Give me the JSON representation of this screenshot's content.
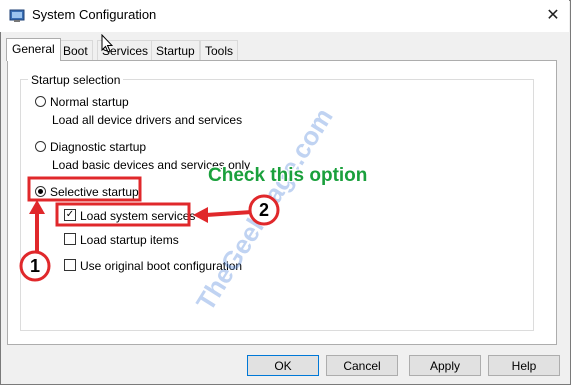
{
  "window": {
    "title": "System Configuration",
    "close_glyph": "✕"
  },
  "tabs": [
    {
      "label": "General"
    },
    {
      "label": "Boot"
    },
    {
      "label": "Services"
    },
    {
      "label": "Startup"
    },
    {
      "label": "Tools"
    }
  ],
  "general": {
    "group_label": "Startup selection",
    "normal": {
      "label": "Normal startup",
      "desc": "Load all device drivers and services"
    },
    "diagnostic": {
      "label": "Diagnostic startup",
      "desc": "Load basic devices and services only"
    },
    "selective": {
      "label": "Selective startup",
      "selected": true
    },
    "options": [
      {
        "label": "Load system services",
        "checked": true
      },
      {
        "label": "Load startup items",
        "checked": false
      },
      {
        "label": "Use original boot configuration",
        "checked": false
      }
    ]
  },
  "buttons": {
    "ok": "OK",
    "cancel": "Cancel",
    "apply": "Apply",
    "help": "Help"
  },
  "annotations": {
    "callout": "Check this option",
    "badge1": "1",
    "badge2": "2",
    "watermark": "TheGeekPage.com",
    "highlight_color": "#e0282b",
    "callout_color": "#1aa03c"
  }
}
